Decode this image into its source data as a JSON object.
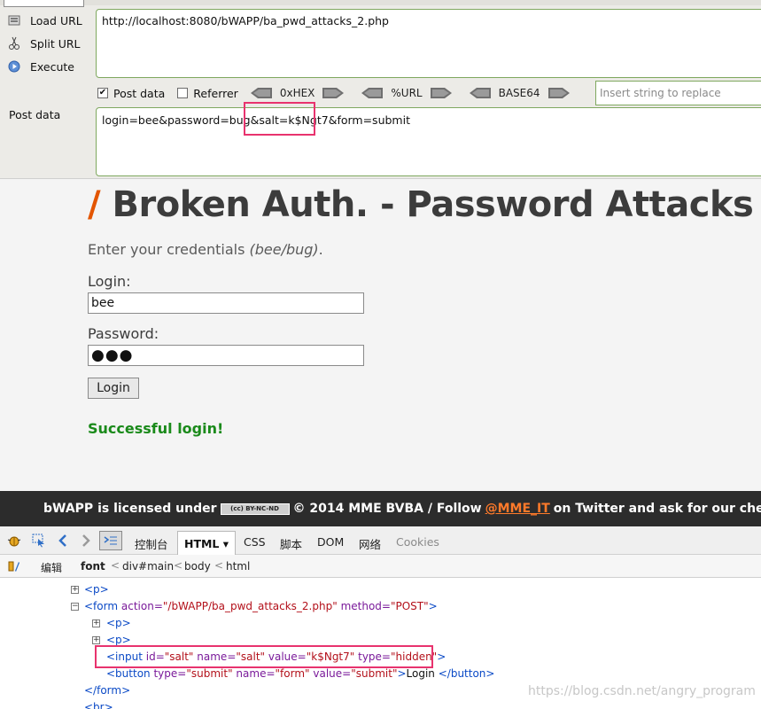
{
  "hackbar": {
    "actions": {
      "load_url": "Load URL",
      "split_url": "Split URL",
      "execute": "Execute"
    },
    "url_value": "http://localhost:8080/bWAPP/ba_pwd_attacks_2.php",
    "options": {
      "post_data_label": "Post data",
      "post_data_checked": "✔",
      "referrer_label": "Referrer",
      "hex_label": "0xHEX",
      "url_label": "%URL",
      "base64_label": "BASE64"
    },
    "replace_placeholder": "Insert string to replace",
    "post_label": "Post data",
    "post_value": "login=bee&password=bug&salt=k$Ngt7&form=submit"
  },
  "page": {
    "title_slash_left": "/",
    "title": "Broken Auth. - Password Attacks",
    "title_slash_right": "/",
    "intro_prefix": "Enter your credentials ",
    "intro_italic": "(bee/bug)",
    "intro_suffix": ".",
    "login_label": "Login:",
    "login_value": "bee",
    "password_label": "Password:",
    "password_mask": "●●●",
    "login_button": "Login",
    "success_message": "Successful login!"
  },
  "footer": {
    "prefix": "bWAPP is licensed under",
    "cc_badge": "(cc) BY-NC-ND",
    "middle": "© 2014 MME BVBA / Follow",
    "twitter": "@MME_IT",
    "suffix": "on Twitter and ask for our cheat sheet, conta"
  },
  "firebug": {
    "tabs": {
      "console": "控制台",
      "html": "HTML ▾",
      "css": "CSS",
      "script": "脚本",
      "dom": "DOM",
      "net": "网络",
      "cookies": "Cookies"
    },
    "breadcrumbs": {
      "edit": "编辑",
      "font": "font",
      "main": "div#main",
      "body": "body",
      "html": "html"
    },
    "tree": {
      "p1": "<p>",
      "form_open": "<form",
      "form_action_attr": "action=",
      "form_action_val": "\"/bWAPP/ba_pwd_attacks_2.php\"",
      "form_method_attr": "method=",
      "form_method_val": "\"POST\"",
      "form_close_bracket": ">",
      "p2": "<p>",
      "p3": "<p>",
      "input_open": "<input",
      "id_attr": "id=",
      "id_val": "\"salt\"",
      "name_attr": "name=",
      "name_val": "\"salt\"",
      "value_attr": "value=",
      "value_val": "\"k$Ngt7\"",
      "type_attr": "type=",
      "type_val": "\"hidden\"",
      "input_close": ">",
      "button_open": "<button",
      "btype_attr": "type=",
      "btype_val": "\"submit\"",
      "bname_attr": "name=",
      "bname_val": "\"form\"",
      "bvalue_attr": "value=",
      "bvalue_val": "\"submit\"",
      "button_gt": ">",
      "button_text": "Login",
      "button_close": "</button>",
      "form_close": "</form>",
      "br": "<br>"
    }
  },
  "watermark": "https://blog.csdn.net/angry_program",
  "colors": {
    "accent_orange": "#e35500",
    "success_green": "#1a8a1a",
    "highlight_pink": "#e8336e",
    "hackbar_border": "#7fa85f"
  }
}
